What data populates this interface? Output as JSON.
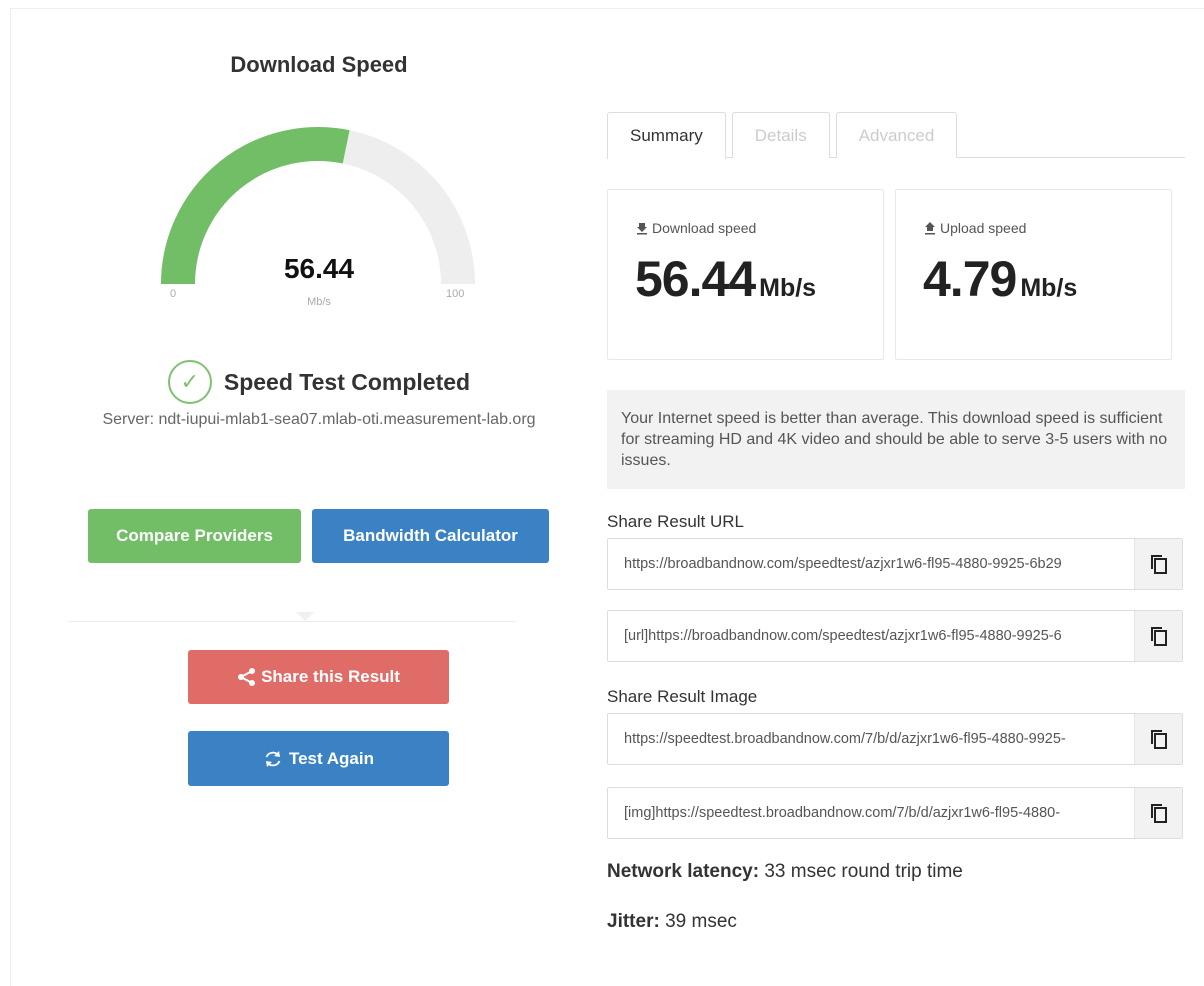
{
  "gauge": {
    "title": "Download Speed",
    "value": "56.44",
    "unit": "Mb/s",
    "min": "0",
    "max": "100",
    "fraction": 0.5644,
    "fill_color": "#72be66",
    "track_color": "#eeeeee"
  },
  "status": {
    "text": "Speed Test Completed",
    "icon": "check-circle-icon",
    "server": "Server: ndt-iupui-mlab1-sea07.mlab-oti.measurement-lab.org"
  },
  "buttons": {
    "compare": "Compare Providers",
    "bandwidth": "Bandwidth Calculator",
    "share": "Share this Result",
    "again": "Test Again"
  },
  "tabs": [
    {
      "label": "Summary",
      "active": true
    },
    {
      "label": "Details",
      "active": false
    },
    {
      "label": "Advanced",
      "active": false
    }
  ],
  "download": {
    "label": "Download speed",
    "value": "56.44",
    "unit": "Mb/s"
  },
  "upload": {
    "label": "Upload speed",
    "value": "4.79",
    "unit": "Mb/s"
  },
  "notice": "Your Internet speed is better than average. This download speed is sufficient for streaming HD and 4K video and should be able to serve 3-5 users with no issues.",
  "share_url": {
    "label": "Share Result URL",
    "url": "https://broadbandnow.com/speedtest/azjxr1w6-fl95-4880-9925-6b29",
    "bbcode": "[url]https://broadbandnow.com/speedtest/azjxr1w6-fl95-4880-9925-6"
  },
  "share_image": {
    "label": "Share Result Image",
    "url": "https://speedtest.broadbandnow.com/7/b/d/azjxr1w6-fl95-4880-9925-",
    "bbcode": "[img]https://speedtest.broadbandnow.com/7/b/d/azjxr1w6-fl95-4880-"
  },
  "latency": {
    "label": "Network latency:",
    "value": "33 msec round trip time"
  },
  "jitter": {
    "label": "Jitter:",
    "value": "39 msec"
  },
  "colors": {
    "green": "#72be66",
    "blue": "#3a82c4",
    "red": "#e06c68"
  }
}
